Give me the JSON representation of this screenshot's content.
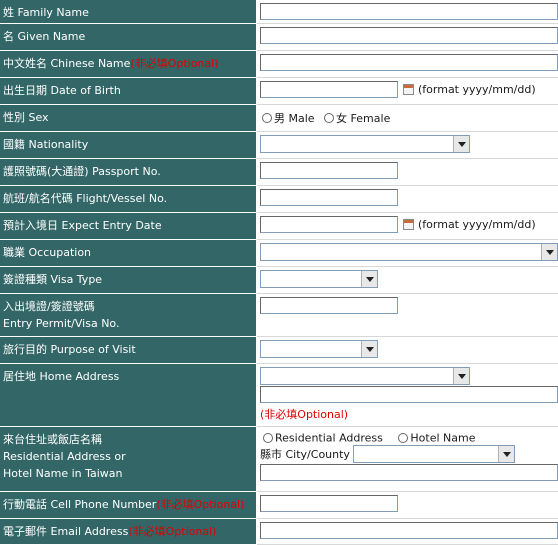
{
  "fields": {
    "family_name": {
      "label": "姓 Family Name"
    },
    "given_name": {
      "label": "名 Given Name"
    },
    "chinese_name": {
      "label": "中文姓名 Chinese Name",
      "optional": "(非必填Optional)"
    },
    "birth_date": {
      "label": "出生日期 Date of Birth",
      "hint": "(format yyyy/mm/dd)"
    },
    "sex": {
      "label": "性別 Sex",
      "option_male": "男 Male",
      "option_female": "女 Female"
    },
    "nationality": {
      "label": "國籍 Nationality"
    },
    "passport": {
      "label": "護照號碼(大通證) Passport No."
    },
    "flight": {
      "label": "航班/航名代碼 Flight/Vessel No."
    },
    "entry_date": {
      "label": "預計入境日 Expect Entry Date",
      "hint": "(format yyyy/mm/dd)"
    },
    "occupation": {
      "label": "職業 Occupation"
    },
    "visa_type": {
      "label": "簽證種類 Visa Type"
    },
    "entry_permit": {
      "label_line1": "入出境證/簽證號碼",
      "label_line2": "Entry Permit/Visa No."
    },
    "purpose": {
      "label": "旅行目的 Purpose of Visit"
    },
    "home_address": {
      "label": "居住地 Home Address",
      "optional": "(非必填Optional)"
    },
    "taiwan_address": {
      "label_line1": "來台住址或飯店名稱",
      "label_line2": "Residential Address or",
      "label_line3": "Hotel Name in Taiwan",
      "option_residential": "Residential Address",
      "option_hotel": "Hotel Name",
      "city_label": "縣市 City/County"
    },
    "cell_phone": {
      "label": "行動電話 Cell Phone Number",
      "optional": "(非必填Optional)"
    },
    "email": {
      "label": "電子郵件 Email Address",
      "optional": "(非必填Optional)"
    }
  },
  "icons": {
    "calendar": "calendar-icon",
    "dropdown": "chevron-down-icon",
    "radio": "radio-icon"
  }
}
